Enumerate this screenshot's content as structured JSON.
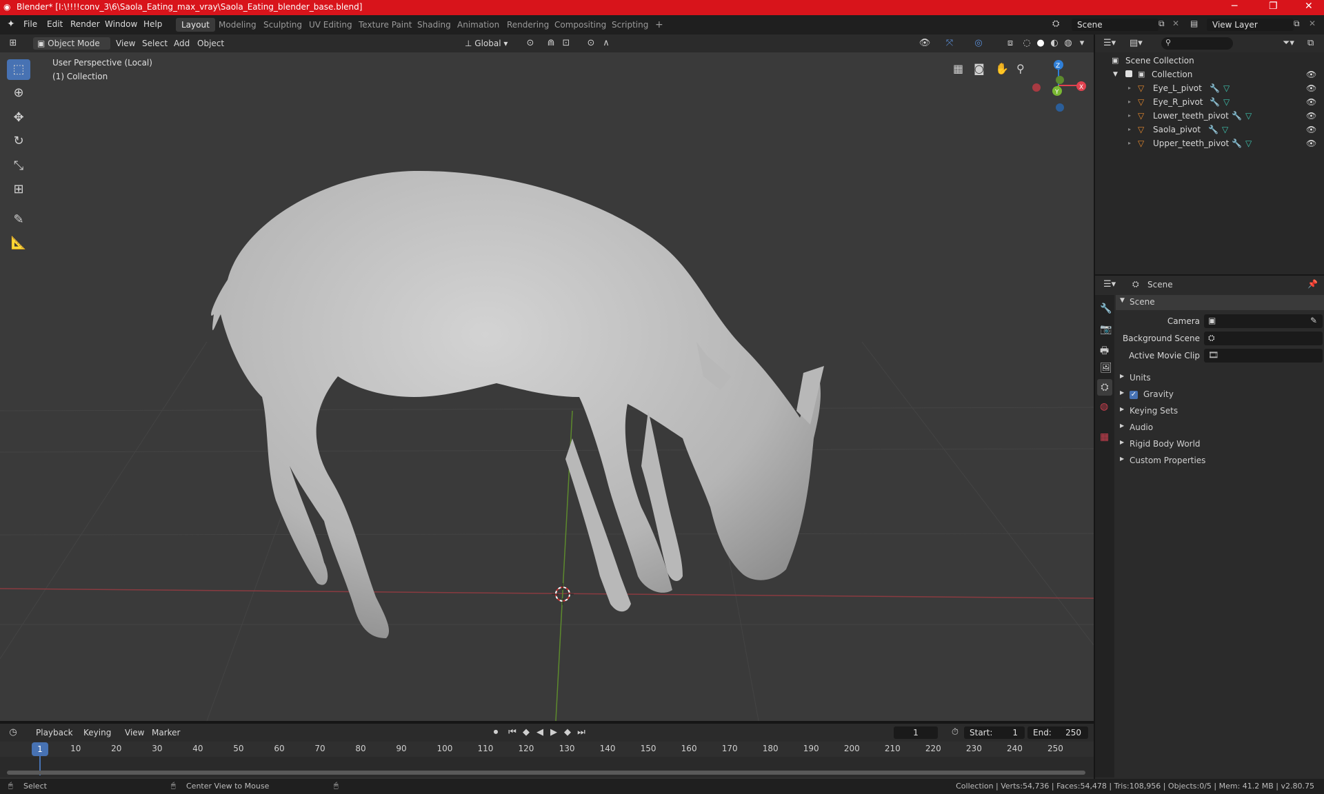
{
  "window": {
    "title": "Blender* [I:\\!!!!conv_3\\6\\Saola_Eating_max_vray\\Saola_Eating_blender_base.blend]",
    "minimize": "─",
    "maximize": "❐",
    "close": "✕"
  },
  "menu": {
    "items": [
      "File",
      "Edit",
      "Render",
      "Window",
      "Help"
    ],
    "workspaces": [
      "Layout",
      "Modeling",
      "Sculpting",
      "UV Editing",
      "Texture Paint",
      "Shading",
      "Animation",
      "Rendering",
      "Compositing",
      "Scripting"
    ],
    "active_workspace": "Layout",
    "add_workspace": "+",
    "scene_name": "Scene",
    "view_layer": "View Layer"
  },
  "viewport_header": {
    "mode": "Object Mode",
    "menus": [
      "View",
      "Select",
      "Add",
      "Object"
    ],
    "transform_orientation": "Global"
  },
  "viewport": {
    "perspective_label": "User Perspective (Local)",
    "collection_label": "(1) Collection",
    "gizmo": {
      "x": "X",
      "y": "Y",
      "z": "Z"
    }
  },
  "outliner": {
    "root": "Scene Collection",
    "collection": "Collection",
    "objects": [
      "Eye_L_pivot",
      "Eye_R_pivot",
      "Lower_teeth_pivot",
      "Saola_pivot",
      "Upper_teeth_pivot"
    ]
  },
  "properties": {
    "context": "Scene",
    "panel_title": "Scene",
    "fields": [
      {
        "label": "Camera",
        "value": ""
      },
      {
        "label": "Background Scene",
        "value": ""
      },
      {
        "label": "Active Movie Clip",
        "value": ""
      }
    ],
    "sections": [
      {
        "label": "Units",
        "checkbox": false
      },
      {
        "label": "Gravity",
        "checkbox": true
      },
      {
        "label": "Keying Sets",
        "checkbox": false
      },
      {
        "label": "Audio",
        "checkbox": false
      },
      {
        "label": "Rigid Body World",
        "checkbox": false
      },
      {
        "label": "Custom Properties",
        "checkbox": false
      }
    ]
  },
  "timeline": {
    "menus": [
      "Playback",
      "Keying",
      "View",
      "Marker"
    ],
    "current_frame": "1",
    "start_label": "Start:",
    "start": "1",
    "end_label": "End:",
    "end": "250",
    "ticks": [
      "1",
      "10",
      "20",
      "30",
      "40",
      "50",
      "60",
      "70",
      "80",
      "90",
      "100",
      "110",
      "120",
      "130",
      "140",
      "150",
      "160",
      "170",
      "180",
      "190",
      "200",
      "210",
      "220",
      "230",
      "240",
      "250"
    ]
  },
  "status": {
    "left_action": "Select",
    "middle_action": "Center View to Mouse",
    "stats": "Collection | Verts:54,736 | Faces:54,478 | Tris:108,956 | Objects:0/5 | Mem: 41.2 MB | v2.80.75"
  },
  "colors": {
    "title_bar": "#d8141b",
    "accent": "#4772b3",
    "x_axis": "#e0424f",
    "y_axis": "#7ab833",
    "z_axis": "#2f7fd8",
    "object_icon": "#e88a2e"
  }
}
